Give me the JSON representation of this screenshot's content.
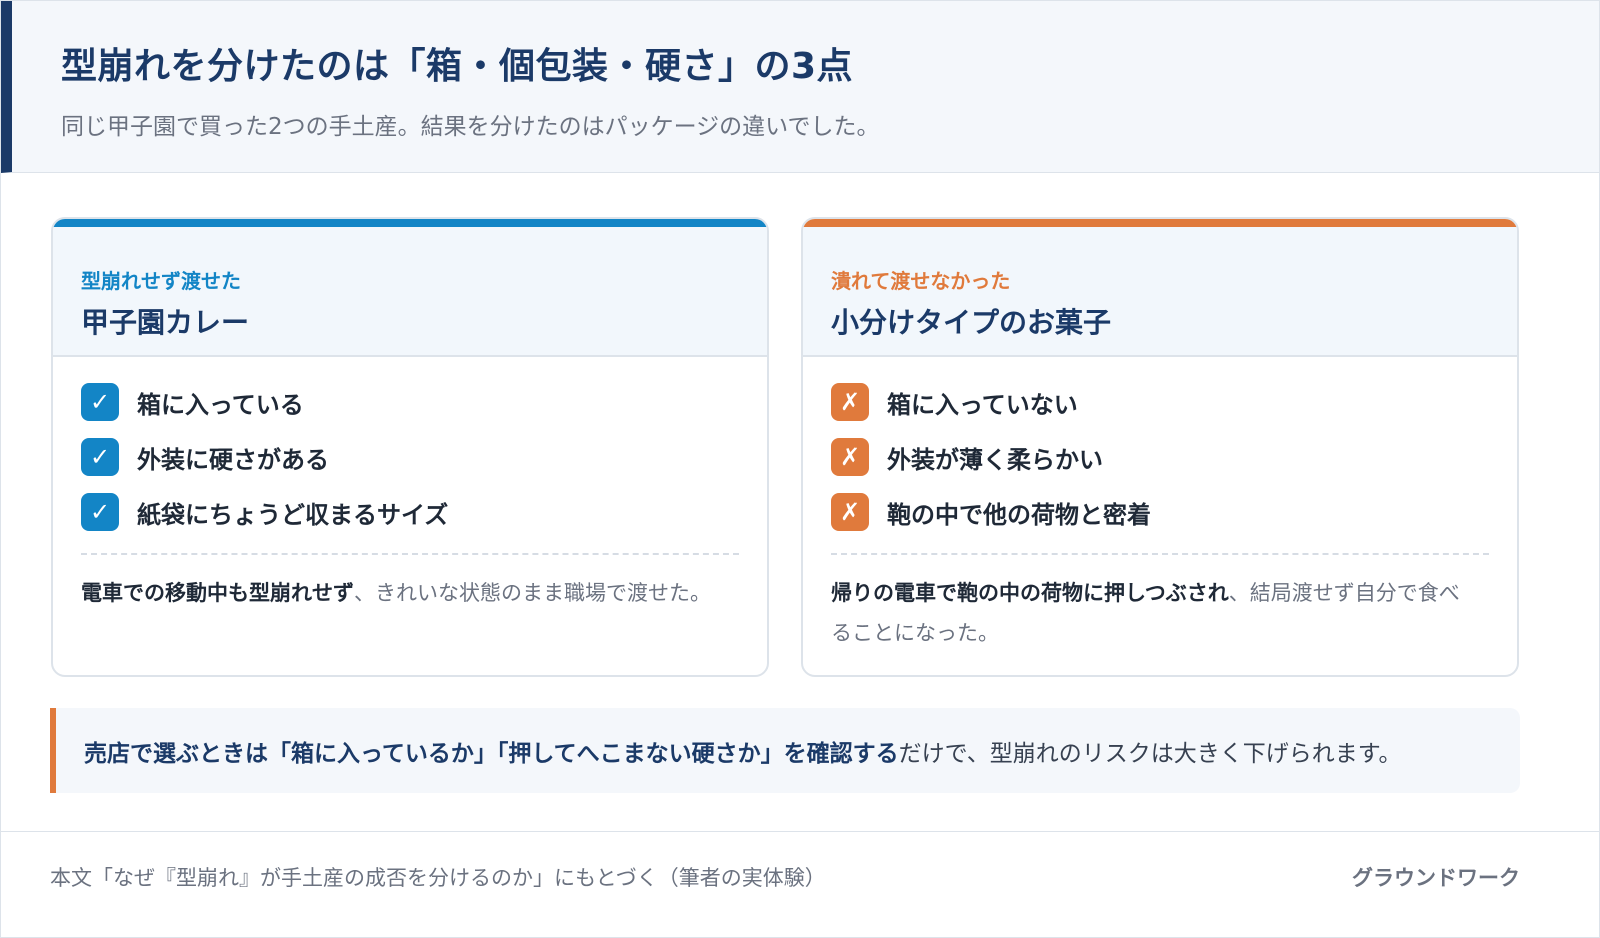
{
  "header": {
    "title": "型崩れを分けたのは「箱・個包装・硬さ」の3点",
    "subtitle": "同じ甲子園で買った2つの手土産。結果を分けたのはパッケージの違いでした。"
  },
  "left_panel": {
    "kicker": "型崩れせず渡せた",
    "title": "甲子園カレー",
    "mark": "✓",
    "items": [
      {
        "label": "箱に入っている"
      },
      {
        "label": "外装に硬さがある"
      },
      {
        "label": "紙袋にちょうど収まるサイズ"
      }
    ],
    "note_strong": "電車での移動中も型崩れせず",
    "note_rest": "、きれいな状態のまま職場で渡せた。"
  },
  "right_panel": {
    "kicker": "潰れて渡せなかった",
    "title": "小分けタイプのお菓子",
    "mark": "✗",
    "items": [
      {
        "label": "箱に入っていない"
      },
      {
        "label": "外装が薄く柔らかい"
      },
      {
        "label": "鞄の中で他の荷物と密着"
      }
    ],
    "note_strong": "帰りの電車で鞄の中の荷物に押しつぶされ",
    "note_rest": "、結局渡せず自分で食べることになった。"
  },
  "callout": {
    "strong": "売店で選ぶときは「箱に入っているか」「押してへこまない硬さか」を確認する",
    "rest": "だけで、型崩れのリスクは大きく下げられます。"
  },
  "footer": {
    "source": "本文「なぜ『型崩れ』が手土産の成否を分けるのか」にもとづく（筆者の実体験）",
    "brand": "グラウンドワーク"
  },
  "colors": {
    "navy": "#1b3a68",
    "blue": "#1385c6",
    "orange": "#e07a3c"
  },
  "icons": {
    "good": "check-icon",
    "bad": "cross-icon"
  }
}
